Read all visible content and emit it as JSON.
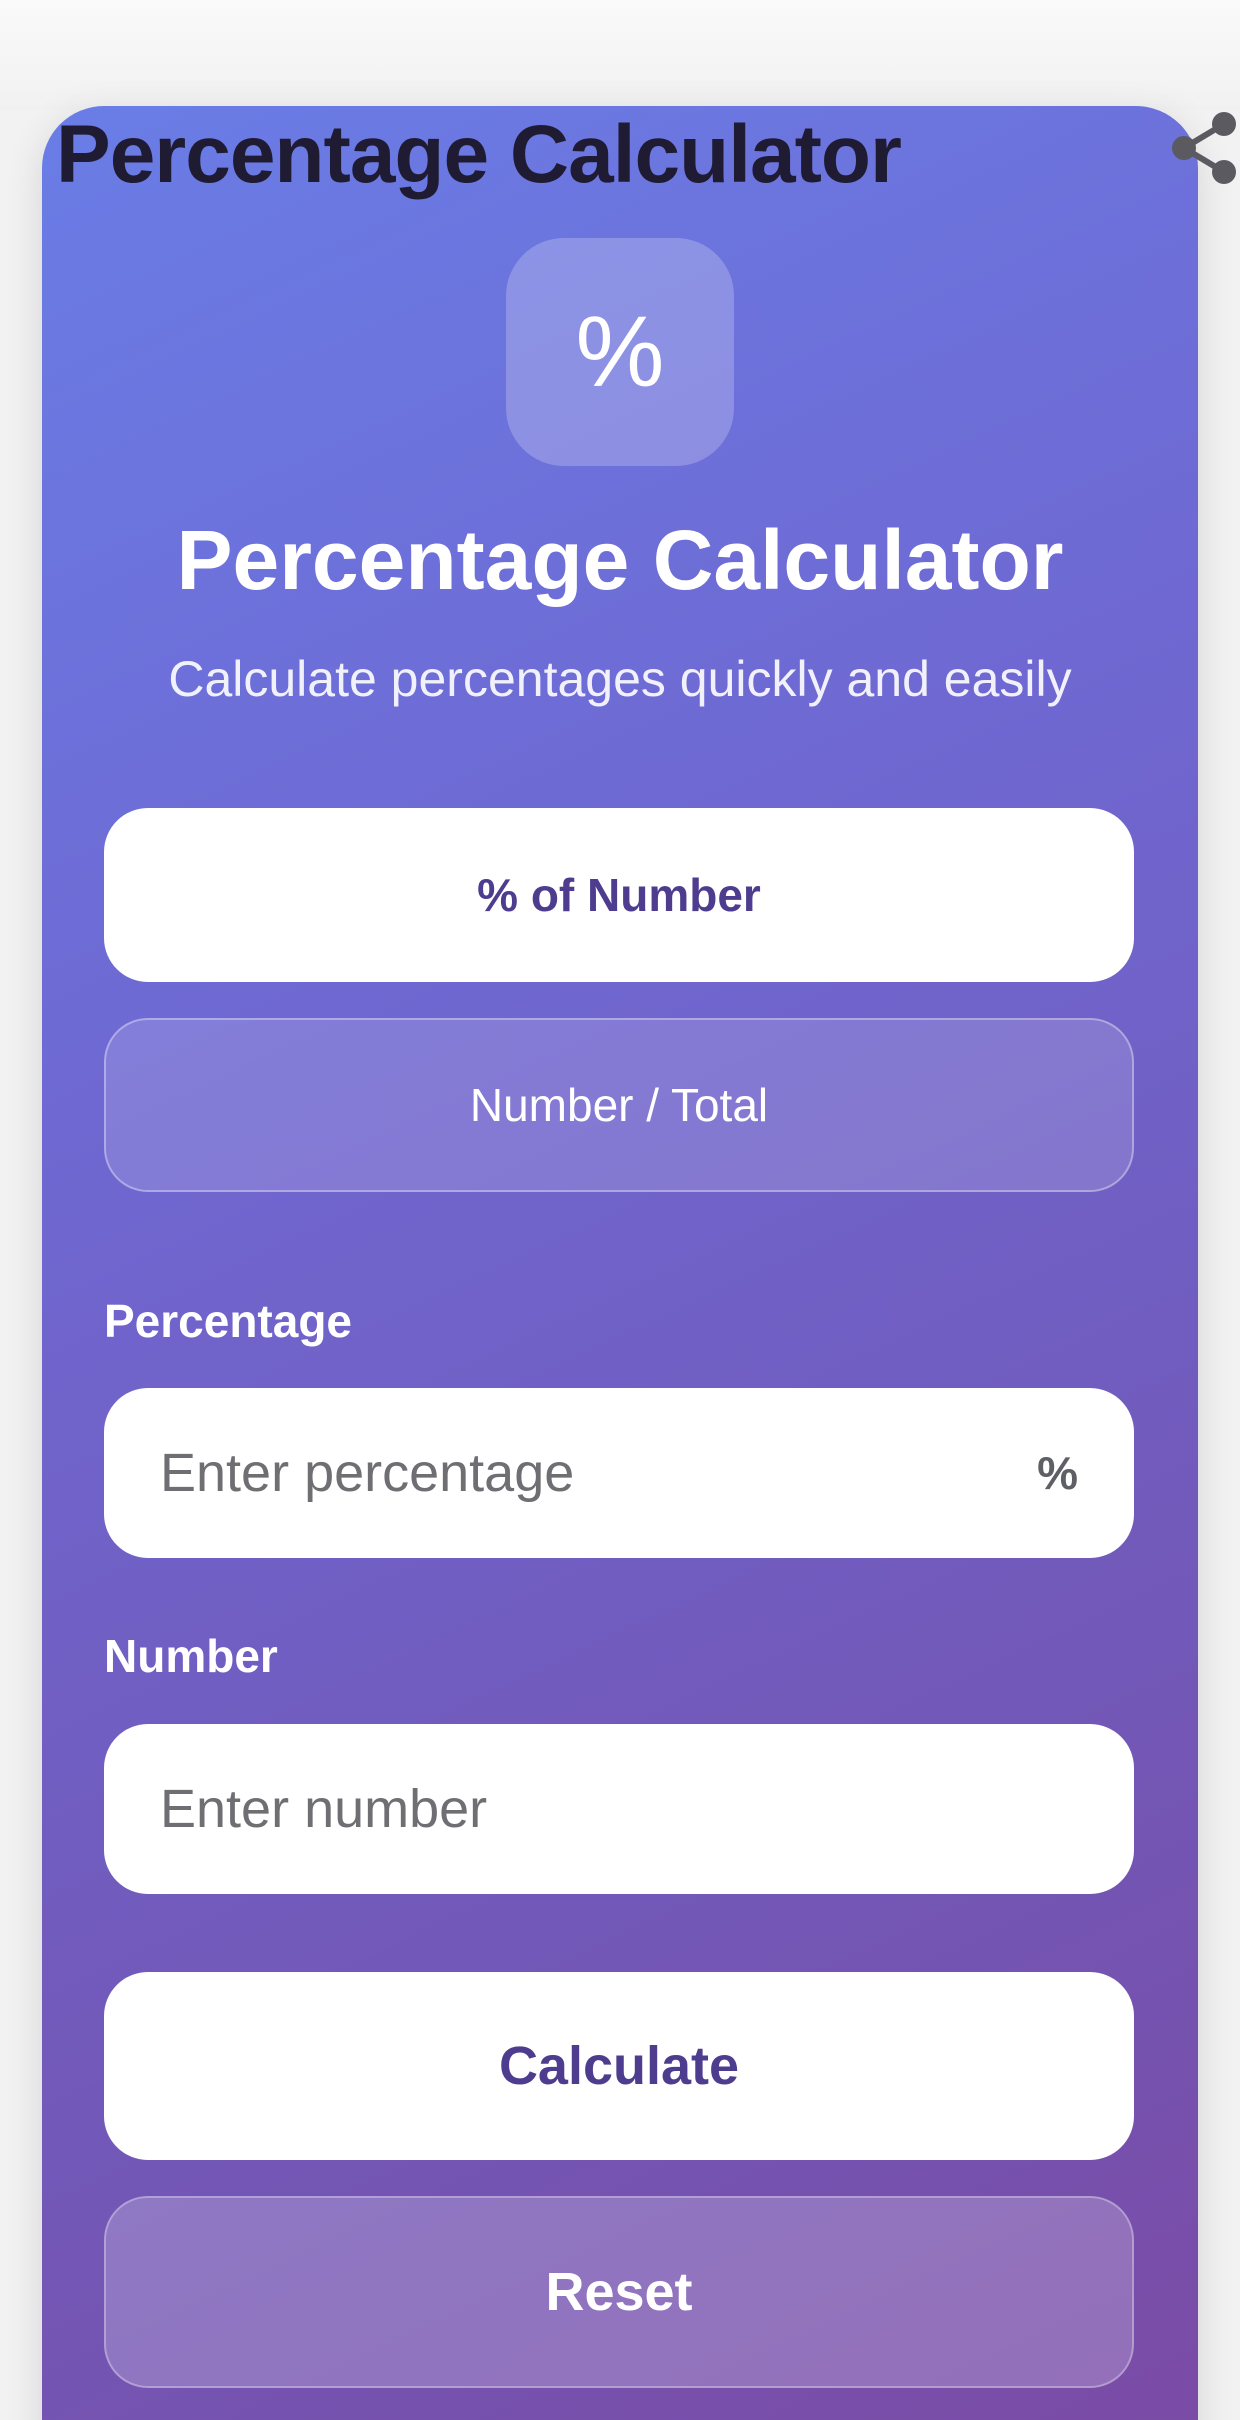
{
  "header": {
    "title": "Percentage Calculator",
    "share_icon": "share-icon"
  },
  "hero": {
    "icon_glyph": "%",
    "title": "Percentage Calculator",
    "subtitle": "Calculate percentages quickly and easily"
  },
  "modes": [
    {
      "label": "% of Number",
      "selected": true
    },
    {
      "label": "Number / Total",
      "selected": false
    }
  ],
  "fields": {
    "percentage": {
      "label": "Percentage",
      "placeholder": "Enter percentage",
      "value": "",
      "suffix": "%"
    },
    "number": {
      "label": "Number",
      "placeholder": "Enter number",
      "value": ""
    }
  },
  "actions": {
    "calculate_label": "Calculate",
    "reset_label": "Reset"
  },
  "colors": {
    "gradient_start": "#6a7de6",
    "gradient_end": "#7b4aa4",
    "accent_text": "#4e3d8f",
    "title_text": "#1f1b33"
  }
}
